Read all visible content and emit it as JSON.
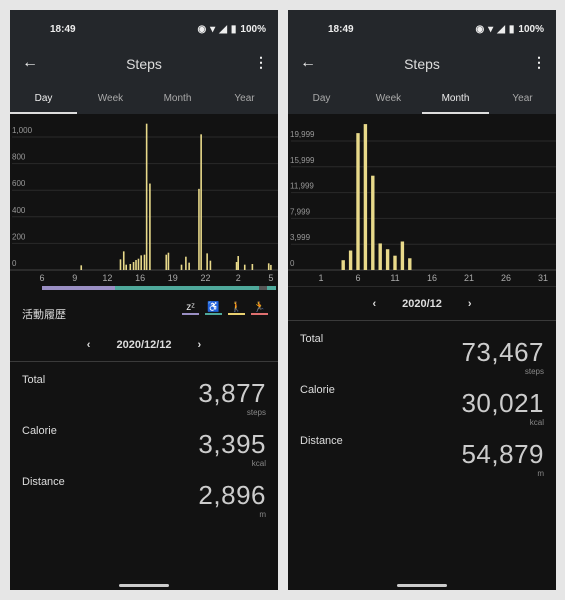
{
  "colors": {
    "bar": "#e8d98a",
    "grid": "#2a2a2a",
    "sleep": "#9a8fc4",
    "sit": "#4fa99b",
    "walk": "#e8d070",
    "run": "#e07070",
    "none": "#555"
  },
  "status": {
    "time": "18:49",
    "battery": "100%",
    "icons": [
      "eye-comfort-icon",
      "wifi-icon",
      "signal-icon",
      "battery-icon"
    ]
  },
  "left": {
    "header": {
      "title": "Steps"
    },
    "tabs": [
      {
        "label": "Day",
        "active": true
      },
      {
        "label": "Week"
      },
      {
        "label": "Month"
      },
      {
        "label": "Year"
      }
    ],
    "activity_label": "活動履歴",
    "legend": [
      {
        "icon": "sleep-icon",
        "glyph": "zᶻ"
      },
      {
        "icon": "sitting-icon",
        "glyph": "♿"
      },
      {
        "icon": "walking-icon",
        "glyph": "🚶"
      },
      {
        "icon": "running-icon",
        "glyph": "🏃"
      }
    ],
    "activity_segments": [
      {
        "type": "sleep",
        "from": 6,
        "to": 13.2
      },
      {
        "type": "sit",
        "from": 13.2,
        "to": 27.5
      },
      {
        "type": "none",
        "from": 27.5,
        "to": 28.3
      },
      {
        "type": "sit",
        "from": 28.3,
        "to": 29.2
      }
    ],
    "date": "2020/12/12",
    "stats": [
      {
        "label": "Total",
        "value": "3,877",
        "unit": "steps"
      },
      {
        "label": "Calorie",
        "value": "3,395",
        "unit": "kcal"
      },
      {
        "label": "Distance",
        "value": "2,896",
        "unit": "m"
      }
    ]
  },
  "right": {
    "header": {
      "title": "Steps"
    },
    "tabs": [
      {
        "label": "Day"
      },
      {
        "label": "Week"
      },
      {
        "label": "Month",
        "active": true
      },
      {
        "label": "Year"
      }
    ],
    "date": "2020/12",
    "stats": [
      {
        "label": "Total",
        "value": "73,467",
        "unit": "steps"
      },
      {
        "label": "Calorie",
        "value": "30,021",
        "unit": "kcal"
      },
      {
        "label": "Distance",
        "value": "54,879",
        "unit": "m"
      }
    ]
  },
  "chart_data": [
    {
      "type": "bar",
      "xlabel": "",
      "ylabel": "",
      "ylim": [
        0,
        1000
      ],
      "y_ticks": [
        "0",
        "200",
        "400",
        "600",
        "800",
        "1,000"
      ],
      "y_tick_values": [
        0,
        200,
        400,
        600,
        800,
        1000
      ],
      "x_ticks": [
        "6",
        "9",
        "12",
        "16",
        "19",
        "22",
        "2",
        "5"
      ],
      "x_tick_hours": [
        6,
        9,
        12,
        16,
        19,
        22,
        26,
        29
      ],
      "bars": [
        [
          9.6,
          5
        ],
        [
          13.6,
          50
        ],
        [
          14.0,
          110
        ],
        [
          14.3,
          10
        ],
        [
          14.8,
          15
        ],
        [
          15.2,
          30
        ],
        [
          15.5,
          45
        ],
        [
          15.8,
          55
        ],
        [
          16.1,
          80
        ],
        [
          16.4,
          85
        ],
        [
          16.6,
          1070
        ],
        [
          16.9,
          620
        ],
        [
          18.4,
          85
        ],
        [
          18.6,
          100
        ],
        [
          19.8,
          10
        ],
        [
          20.2,
          70
        ],
        [
          20.5,
          25
        ],
        [
          21.4,
          580
        ],
        [
          21.6,
          990
        ],
        [
          22.2,
          95
        ],
        [
          22.6,
          40
        ],
        [
          25.8,
          30
        ],
        [
          26.0,
          75
        ],
        [
          26.6,
          10
        ],
        [
          27.3,
          15
        ],
        [
          28.8,
          20
        ],
        [
          29.0,
          8
        ]
      ]
    },
    {
      "type": "bar",
      "xlabel": "",
      "ylabel": "",
      "ylim": [
        0,
        19999
      ],
      "y_ticks": [
        "0",
        "3,999",
        "7,999",
        "11,999",
        "15,999",
        "19,999"
      ],
      "y_tick_values": [
        0,
        3999,
        7999,
        11999,
        15999,
        19999
      ],
      "x_ticks": [
        "1",
        "6",
        "11",
        "16",
        "21",
        "26",
        "31"
      ],
      "x_tick_days": [
        1,
        6,
        11,
        16,
        21,
        26,
        31
      ],
      "days": [
        4,
        5,
        6,
        7,
        8,
        9,
        10,
        11,
        12,
        13
      ],
      "values": [
        900,
        2400,
        20600,
        22000,
        14000,
        3500,
        2600,
        1600,
        3800,
        1200
      ]
    }
  ]
}
